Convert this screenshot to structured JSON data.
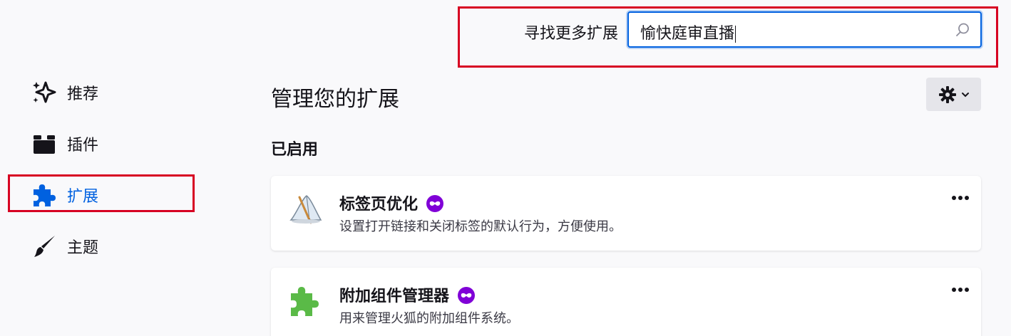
{
  "search": {
    "label": "寻找更多扩展",
    "value": "愉快庭审直播"
  },
  "sidebar": {
    "items": [
      {
        "label": "推荐",
        "icon": "sparkles-icon"
      },
      {
        "label": "插件",
        "icon": "plugin-icon"
      },
      {
        "label": "扩展",
        "icon": "puzzle-icon",
        "active": true
      },
      {
        "label": "主题",
        "icon": "brush-icon"
      }
    ]
  },
  "main": {
    "title": "管理您的扩展",
    "section_enabled": "已启用",
    "extensions": [
      {
        "name": "标签页优化",
        "description": "设置打开链接和关闭标签的默认行为，方便使用。",
        "icon": "tab-optimize-icon"
      },
      {
        "name": "附加组件管理器",
        "description": "用来管理火狐的附加组件系统。",
        "icon": "green-puzzle-icon"
      }
    ]
  },
  "colors": {
    "accent": "#0061e0",
    "highlight_border": "#d70022",
    "private_badge": "#8000d7"
  }
}
